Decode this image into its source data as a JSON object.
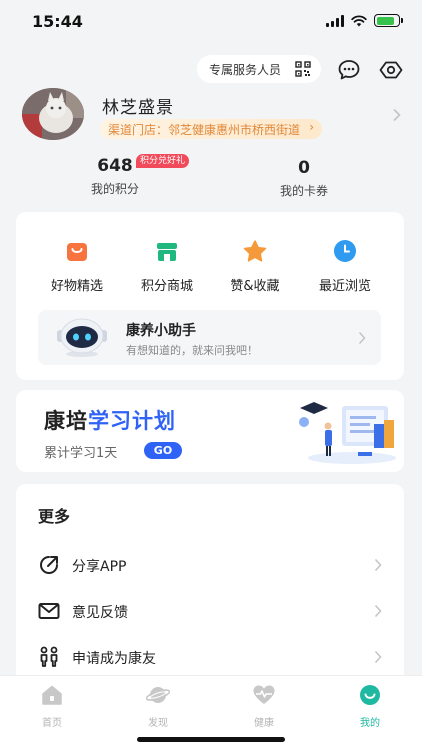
{
  "status": {
    "time": "15:44"
  },
  "header": {
    "service_label": "专属服务人员",
    "username": "林芝盛景",
    "store_tag": "渠道门店：邻芝健康惠州市桥西街道"
  },
  "stats": {
    "points_value": "648",
    "points_label": "我的积分",
    "points_badge": "积分兑好礼",
    "coupons_value": "0",
    "coupons_label": "我的卡券"
  },
  "features": [
    {
      "label": "好物精选",
      "icon": "shopping-bag-icon",
      "color": "#f7743f"
    },
    {
      "label": "积分商城",
      "icon": "store-icon",
      "color": "#1fb97f"
    },
    {
      "label": "赞&收藏",
      "icon": "star-icon",
      "color": "#f59a3a"
    },
    {
      "label": "最近浏览",
      "icon": "clock-icon",
      "color": "#2e9bf0"
    }
  ],
  "assistant": {
    "title": "康养小助手",
    "subtitle": "有想知道的，就来问我吧！"
  },
  "study": {
    "title_prefix": "康培",
    "title_accent": "学习计划",
    "subtitle": "累计学习1天",
    "go_label": "GO"
  },
  "more": {
    "title": "更多",
    "items": [
      {
        "label": "分享APP",
        "icon": "share-icon"
      },
      {
        "label": "意见反馈",
        "icon": "mail-icon"
      },
      {
        "label": "申请成为康友",
        "icon": "people-icon"
      }
    ]
  },
  "tabbar": {
    "tabs": [
      {
        "label": "首页",
        "icon": "home-icon",
        "active": false
      },
      {
        "label": "发现",
        "icon": "planet-icon",
        "active": false
      },
      {
        "label": "健康",
        "icon": "heartbeat-icon",
        "active": false
      },
      {
        "label": "我的",
        "icon": "smile-icon",
        "active": true
      }
    ]
  },
  "colors": {
    "accent_blue": "#2f63f6",
    "accent_green": "#1fb9a1",
    "badge_red": "#f04a5b",
    "tag_orange": "#e0883a"
  }
}
